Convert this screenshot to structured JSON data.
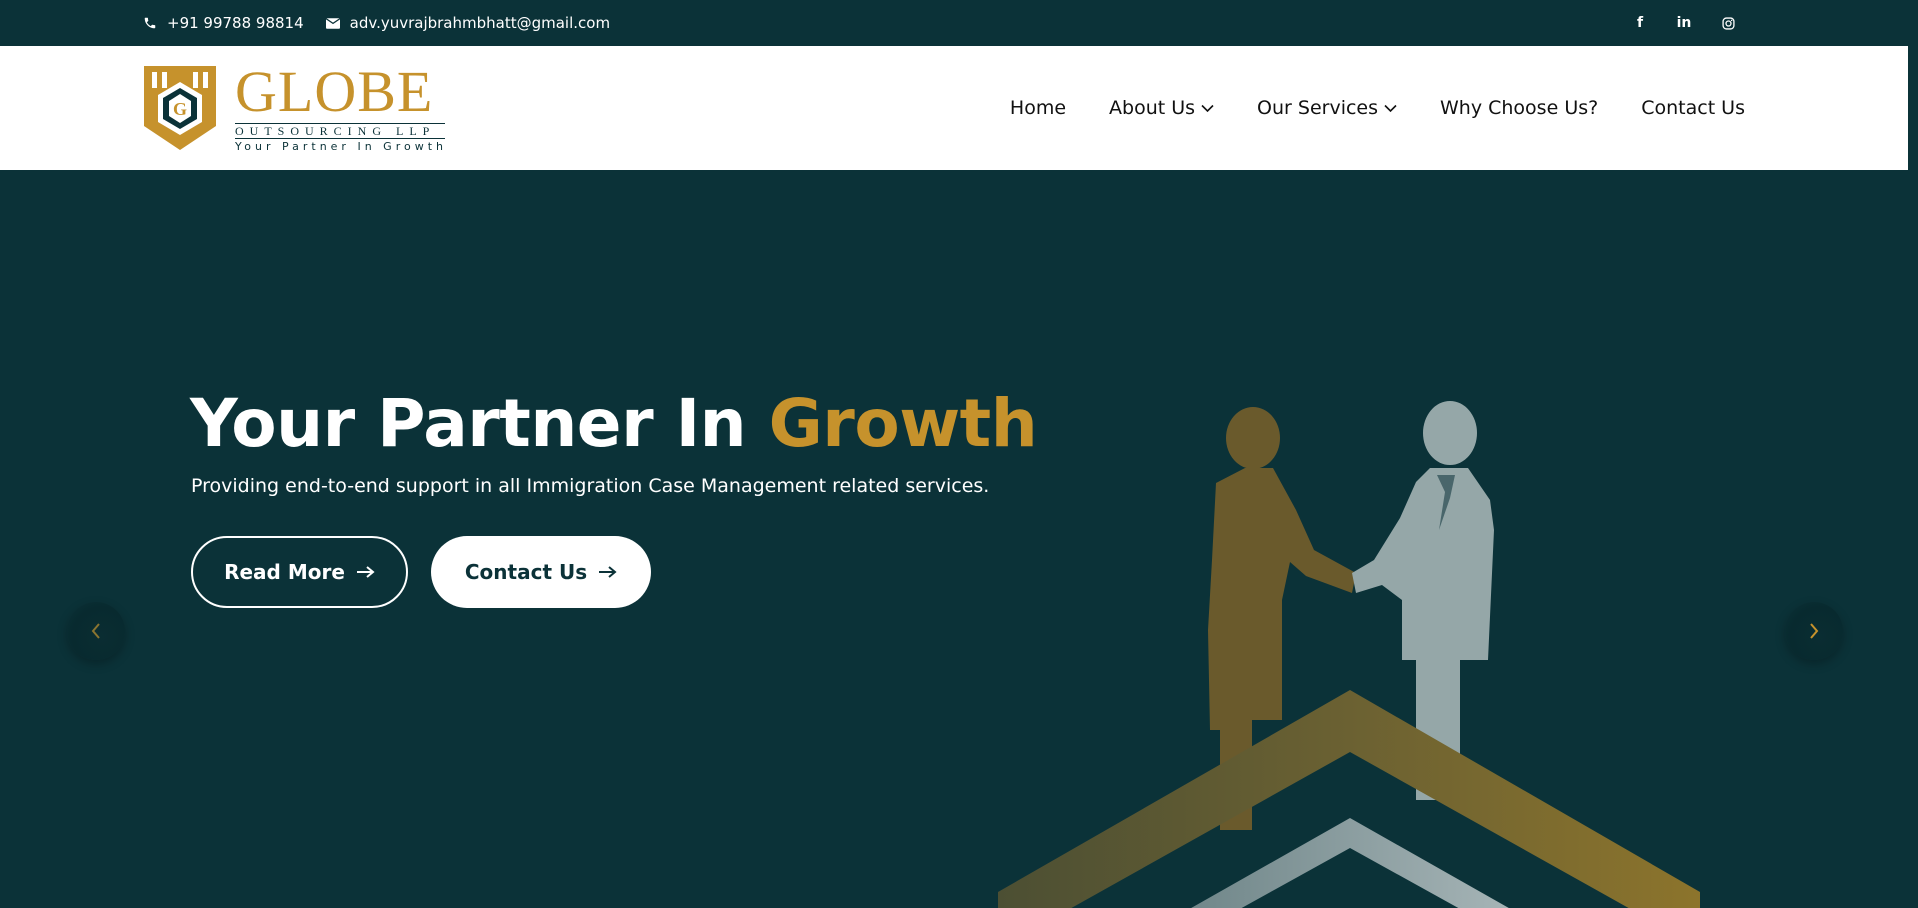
{
  "topbar": {
    "phone": "+91 99788 98814",
    "email": "adv.yuvrajbrahmbhatt@gmail.com",
    "social": [
      {
        "name": "facebook-icon",
        "glyph": "f"
      },
      {
        "name": "linkedin-icon",
        "glyph": "in"
      },
      {
        "name": "instagram-icon",
        "glyph": ""
      }
    ]
  },
  "logo": {
    "title": "GLOBE",
    "subtitle": "OUTSOURCING LLP",
    "tagline": "Your Partner In Growth"
  },
  "nav": {
    "items": [
      {
        "label": "Home",
        "dropdown": false
      },
      {
        "label": "About Us",
        "dropdown": true
      },
      {
        "label": "Our Services",
        "dropdown": true
      },
      {
        "label": "Why Choose Us?",
        "dropdown": false
      },
      {
        "label": "Contact Us",
        "dropdown": false
      }
    ]
  },
  "hero": {
    "title_main": "Your Partner In ",
    "title_accent": "Growth",
    "lead": "Providing end-to-end support in all Immigration Case Management related services.",
    "buttons": {
      "read_more": "Read More",
      "contact": "Contact Us"
    }
  },
  "colors": {
    "primary": "#0b3238",
    "accent": "#c6922c",
    "white": "#ffffff"
  }
}
